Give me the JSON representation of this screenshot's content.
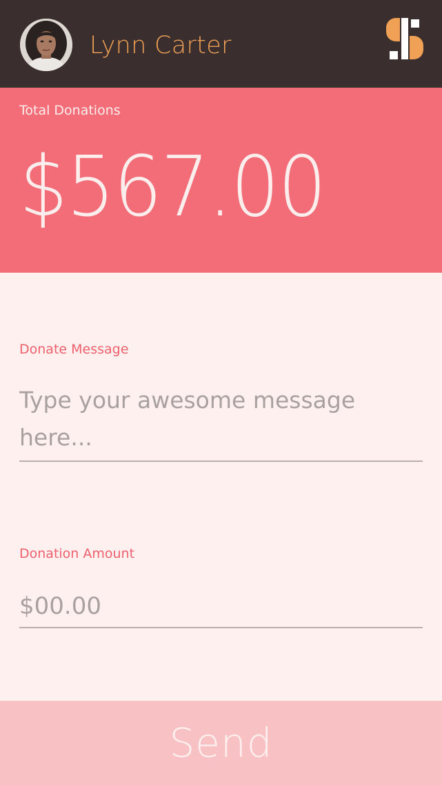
{
  "header": {
    "user_name": "Lynn Carter",
    "avatar_alt": "Lynn Carter profile photo",
    "logo_icon": "app-logo-icon"
  },
  "summary": {
    "label": "Total Donations",
    "amount": "$567.00"
  },
  "form": {
    "message_label": "Donate Message",
    "message_placeholder": "Type your awesome message here...",
    "message_value": "",
    "amount_label": "Donation Amount",
    "amount_placeholder": "$00.00",
    "amount_value": ""
  },
  "actions": {
    "send_label": "Send"
  },
  "colors": {
    "header_bg": "#3a2f2e",
    "accent_orange": "#f0a155",
    "total_panel_bg": "#f26d78",
    "form_bg": "#fdf0ef",
    "label_color": "#ef5f6c",
    "send_bg": "#f8c1c3",
    "send_text": "#fdf0ef"
  }
}
